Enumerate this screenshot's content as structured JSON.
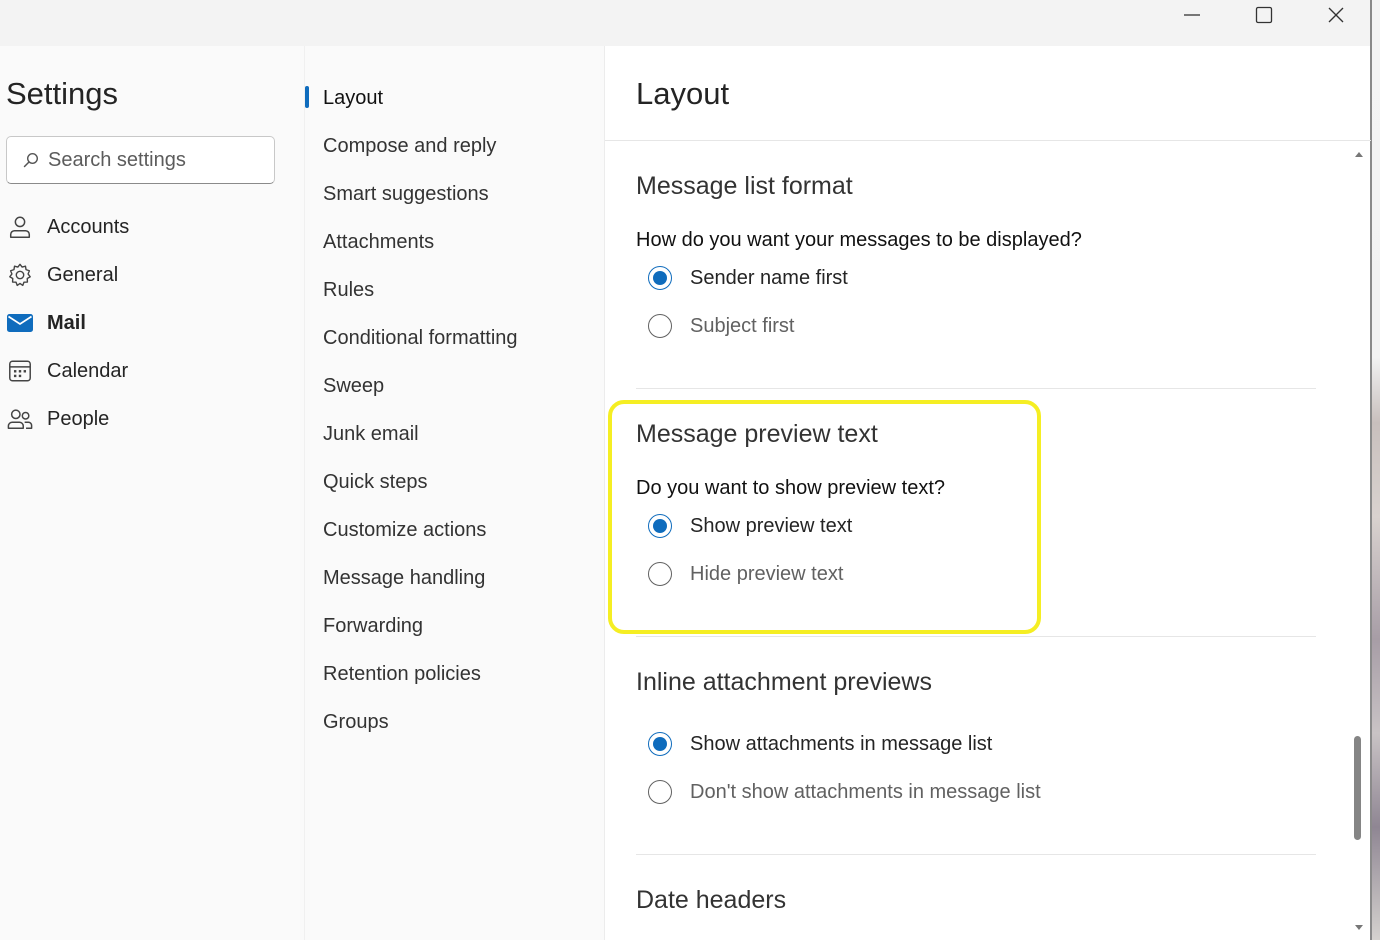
{
  "window": {
    "controls": [
      "minimize-icon",
      "maximize-icon",
      "close-icon"
    ]
  },
  "settings": {
    "title": "Settings",
    "search": {
      "placeholder": "Search settings",
      "value": ""
    },
    "nav": [
      {
        "label": "Accounts",
        "icon": "person-icon"
      },
      {
        "label": "General",
        "icon": "gear-icon"
      },
      {
        "label": "Mail",
        "icon": "mail-icon",
        "active": true
      },
      {
        "label": "Calendar",
        "icon": "calendar-icon"
      },
      {
        "label": "People",
        "icon": "people-icon"
      }
    ]
  },
  "mail_settings": {
    "items": [
      {
        "label": "Layout",
        "active": true
      },
      {
        "label": "Compose and reply"
      },
      {
        "label": "Smart suggestions"
      },
      {
        "label": "Attachments"
      },
      {
        "label": "Rules"
      },
      {
        "label": "Conditional formatting"
      },
      {
        "label": "Sweep"
      },
      {
        "label": "Junk email"
      },
      {
        "label": "Quick steps"
      },
      {
        "label": "Customize actions"
      },
      {
        "label": "Message handling"
      },
      {
        "label": "Forwarding"
      },
      {
        "label": "Retention policies"
      },
      {
        "label": "Groups"
      }
    ]
  },
  "content": {
    "title": "Layout",
    "sections": [
      {
        "title": "Message list format",
        "question": "How do you want your messages to be displayed?",
        "options": [
          {
            "label": "Sender name first",
            "selected": true
          },
          {
            "label": "Subject first",
            "selected": false
          }
        ]
      },
      {
        "title": "Message preview text",
        "question": "Do you want to show preview text?",
        "options": [
          {
            "label": "Show preview text",
            "selected": true
          },
          {
            "label": "Hide preview text",
            "selected": false
          }
        ],
        "highlighted": true
      },
      {
        "title": "Inline attachment previews",
        "options": [
          {
            "label": "Show attachments in message list",
            "selected": true
          },
          {
            "label": "Don't show attachments in message list",
            "selected": false
          }
        ]
      },
      {
        "title": "Date headers"
      }
    ]
  },
  "colors": {
    "accent": "#0f6cbd",
    "highlight": "#f5ee23"
  }
}
